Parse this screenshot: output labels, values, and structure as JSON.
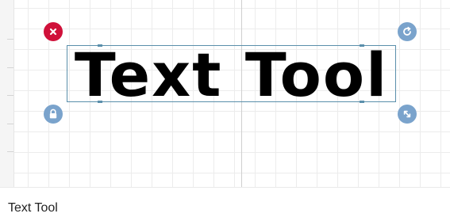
{
  "canvas": {
    "text_object": {
      "text": "Text Tool"
    },
    "handles": {
      "delete": {
        "icon": "close-icon",
        "color": "#d0113a"
      },
      "rotate": {
        "icon": "rotate-icon",
        "color": "#7aa3cc"
      },
      "lock": {
        "icon": "lock-icon",
        "color": "#7aa3cc"
      },
      "scale": {
        "icon": "resize-diagonal-icon",
        "color": "#7aa3cc"
      }
    },
    "selection_color": "#5a8fab"
  },
  "caption": {
    "label": "Text Tool"
  }
}
